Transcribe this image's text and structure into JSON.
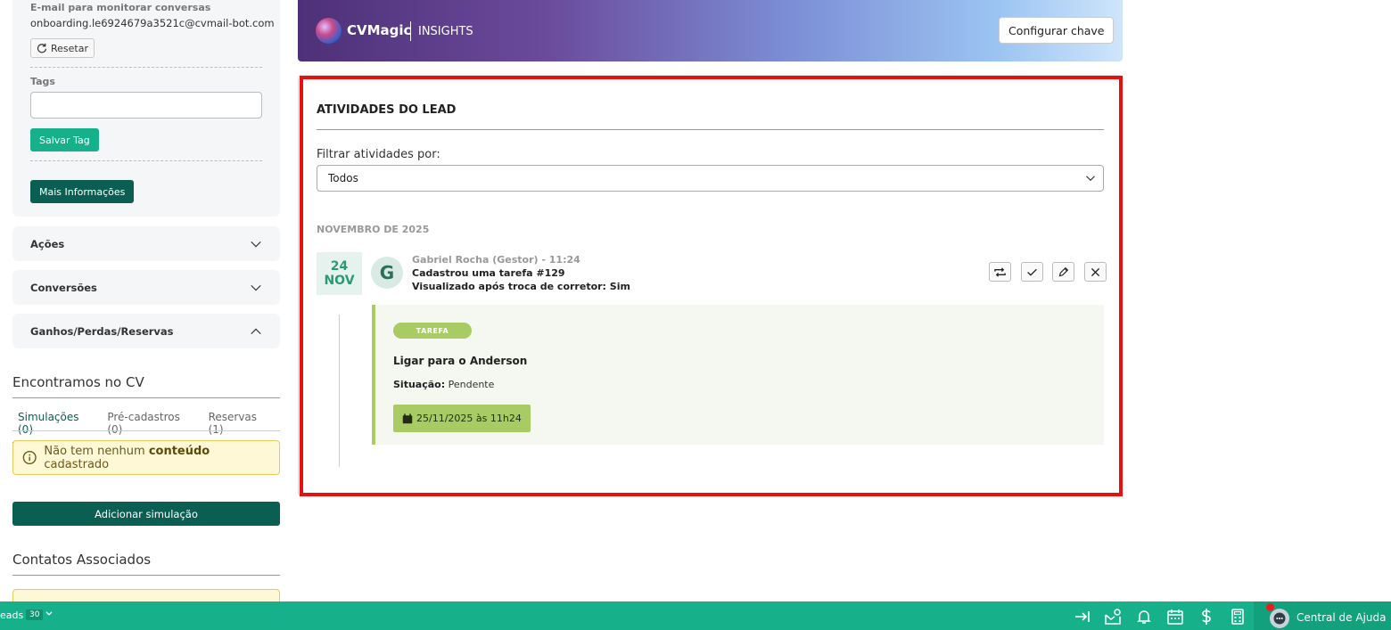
{
  "lead_panel": {
    "email_label": "E-mail para monitorar conversas",
    "email_value": "onboarding.le6924679a3521c@cvmail-bot.com",
    "reset_label": "Resetar",
    "tags_label": "Tags",
    "tags_value": "",
    "save_tag_label": "Salvar Tag",
    "more_info_label": "Mais Informações"
  },
  "accordions": [
    {
      "label": "Ações",
      "expanded": false
    },
    {
      "label": "Conversões",
      "expanded": false
    },
    {
      "label": "Ganhos/Perdas/Reservas",
      "expanded": true
    }
  ],
  "found_cv": {
    "title": "Encontramos no CV",
    "tabs": [
      {
        "label": "Simulações (0)",
        "active": true
      },
      {
        "label": "Pré-cadastros (0)",
        "active": false
      },
      {
        "label": "Reservas (1)",
        "active": false
      }
    ],
    "empty_pre": "Não tem nenhum ",
    "empty_bold": "conteúdo",
    "empty_post": " cadastrado",
    "add_button": "Adicionar simulação"
  },
  "contacts": {
    "title": "Contatos Associados"
  },
  "banner": {
    "brand": "CVMagic",
    "sub": "INSIGHTS",
    "config_button": "Configurar chave"
  },
  "activities": {
    "title": "ATIVIDADES DO LEAD",
    "filter_label": "Filtrar atividades por:",
    "filter_value": "Todos",
    "month_header": "NOVEMBRO DE 2025",
    "items": [
      {
        "day": "24",
        "month": "NOV",
        "avatar_letter": "G",
        "meta": "Gabriel Rocha (Gestor) - 11:24",
        "line1": "Cadastrou uma tarefa #129",
        "line2": "Visualizado após troca de corretor:  Sim",
        "task": {
          "badge": "TAREFA",
          "title": "Ligar para o Anderson",
          "status_label": "Situação:",
          "status_value": " Pendente",
          "due": "25/11/2025 às 11h24"
        }
      }
    ]
  },
  "bottom_bar": {
    "leads_label": "eads",
    "leads_count": "30",
    "help_label": "Central de Ajuda"
  },
  "colors": {
    "primary_green": "#16b08a",
    "dark_green": "#0b5e52",
    "task_green": "#a8cc63",
    "highlight_red": "#e80f0f"
  },
  "icons": [
    "refresh-icon",
    "chevron-down-icon",
    "chevron-up-icon",
    "info-icon",
    "repeat-icon",
    "check-icon",
    "pencil-icon",
    "close-icon",
    "calendar-icon",
    "arrow-to-right-icon",
    "mailbox-icon",
    "bell-icon",
    "calendar-grid-icon",
    "dollar-icon",
    "calculator-icon",
    "chat-icon"
  ]
}
